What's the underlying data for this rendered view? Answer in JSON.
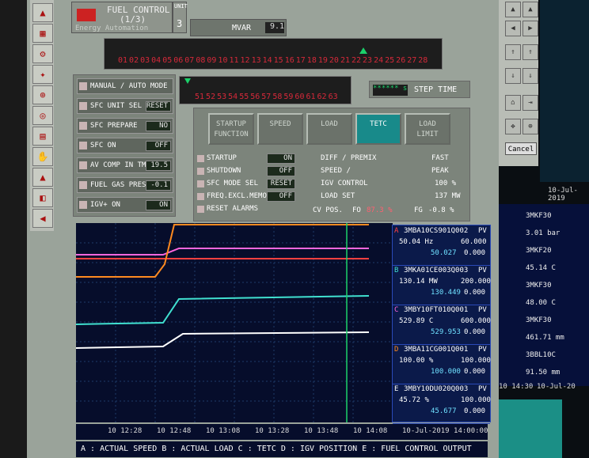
{
  "header": {
    "title": "FUEL CONTROL",
    "page": "(1/3)",
    "subtitle": "Energy Automation",
    "unit_label": "UNIT",
    "unit_value": "3",
    "mvar_label": "MVAR",
    "mvar_value": "9.1"
  },
  "unit_ticks": [
    "01",
    "02",
    "03",
    "04",
    "05",
    "06",
    "07",
    "08",
    "09",
    "10",
    "11",
    "12",
    "13",
    "14",
    "15",
    "16",
    "17",
    "18",
    "19",
    "20",
    "21",
    "22",
    "23",
    "24",
    "25",
    "26",
    "27",
    "28"
  ],
  "unit_ticks2": [
    "51",
    "52",
    "53",
    "54",
    "55",
    "56",
    "57",
    "58",
    "59",
    "60",
    "61",
    "62",
    "63"
  ],
  "step_time": {
    "value": "****** s",
    "label": "STEP TIME"
  },
  "left_controls": [
    {
      "label": "MANUAL / AUTO MODE",
      "value": ""
    },
    {
      "label": "SFC UNIT SEL",
      "value": "RESET"
    },
    {
      "label": "SFC PREPARE",
      "value": "NO"
    },
    {
      "label": "SFC ON",
      "value": "OFF"
    },
    {
      "label": "AV COMP IN TMP",
      "value": "19.5"
    },
    {
      "label": "FUEL GAS PRESS",
      "value": "-0.1"
    },
    {
      "label": "IGV+ ON",
      "value": "ON"
    }
  ],
  "tabs": [
    "STARTUP FUNCTION",
    "SPEED",
    "LOAD",
    "TETC",
    "LOAD LIMIT"
  ],
  "active_tab": "TETC",
  "status_rows": [
    {
      "label": "STARTUP",
      "value": "ON"
    },
    {
      "label": "SHUTDOWN",
      "value": "OFF"
    },
    {
      "label": "SFC MODE SEL",
      "value": "RESET"
    },
    {
      "label": "FREQ.EXCL.MEMORY",
      "value": "OFF"
    },
    {
      "label": "RESET ALARMS",
      "value": ""
    }
  ],
  "mid_rows": {
    "diff": "DIFF / PREMIX",
    "speed": "SPEED /",
    "igv": "IGV CONTROL",
    "load_set": "LOAD SET",
    "cv_pos": "CV POS.",
    "fo": "FO",
    "fo_value": "87.3 %",
    "fg": "FG",
    "fg_value": "-0.8 %",
    "fast": "FAST",
    "peak": "PEAK",
    "igv_value": "100 %",
    "load_value": "137 MW"
  },
  "pv_blocks": [
    {
      "letter": "A",
      "tag": "3MBA10CS901Q002",
      "pv": "PV",
      "value": "50.04 Hz",
      "max": "60.000",
      "cur": "50.027",
      "min": "0.000",
      "color": "#ff4040"
    },
    {
      "letter": "B",
      "tag": "3MKA01CE003Q003",
      "pv": "PV",
      "value": "130.14 MW",
      "max": "200.000",
      "cur": "130.449",
      "min": "0.000",
      "color": "#40e0d0"
    },
    {
      "letter": "C",
      "tag": "3MBY10FT010Q001",
      "pv": "PV",
      "value": "529.89 C",
      "max": "600.000",
      "cur": "529.953",
      "min": "0.000",
      "color": "#ff66dd"
    },
    {
      "letter": "D",
      "tag": "3MBA11CG001Q001",
      "pv": "PV",
      "value": "100.00 %",
      "max": "100.000",
      "cur": "100.000",
      "min": "0.000",
      "color": "#ff8a20"
    },
    {
      "letter": "E",
      "tag": "3MBY10DU020Q003",
      "pv": "PV",
      "value": "45.72 %",
      "max": "100.000",
      "cur": "45.677",
      "min": "0.000",
      "color": "#ffffff"
    }
  ],
  "time_axis": [
    "10 12:28",
    "10 12:48",
    "10 13:08",
    "10 13:28",
    "10 13:48",
    "10 14:08",
    "10-Jul-2019 14:00:00"
  ],
  "legend": "A : ACTUAL SPEED  B : ACTUAL LOAD  C : TETC  D : IGV POSITION  E : FUEL CONTROL OUTPUT",
  "right_panel": {
    "lines": [
      "3MKF30",
      "3.01 bar",
      "3MKF20",
      "45.14 C",
      "3MKF30",
      "48.00 C",
      "3MKF30",
      "461.71 mm",
      "3BBL10C",
      "91.50 mm"
    ],
    "date": "10-Jul-2019",
    "times": [
      "10 14:30",
      "10-Jul-20"
    ],
    "cancel": "Cancel"
  }
}
